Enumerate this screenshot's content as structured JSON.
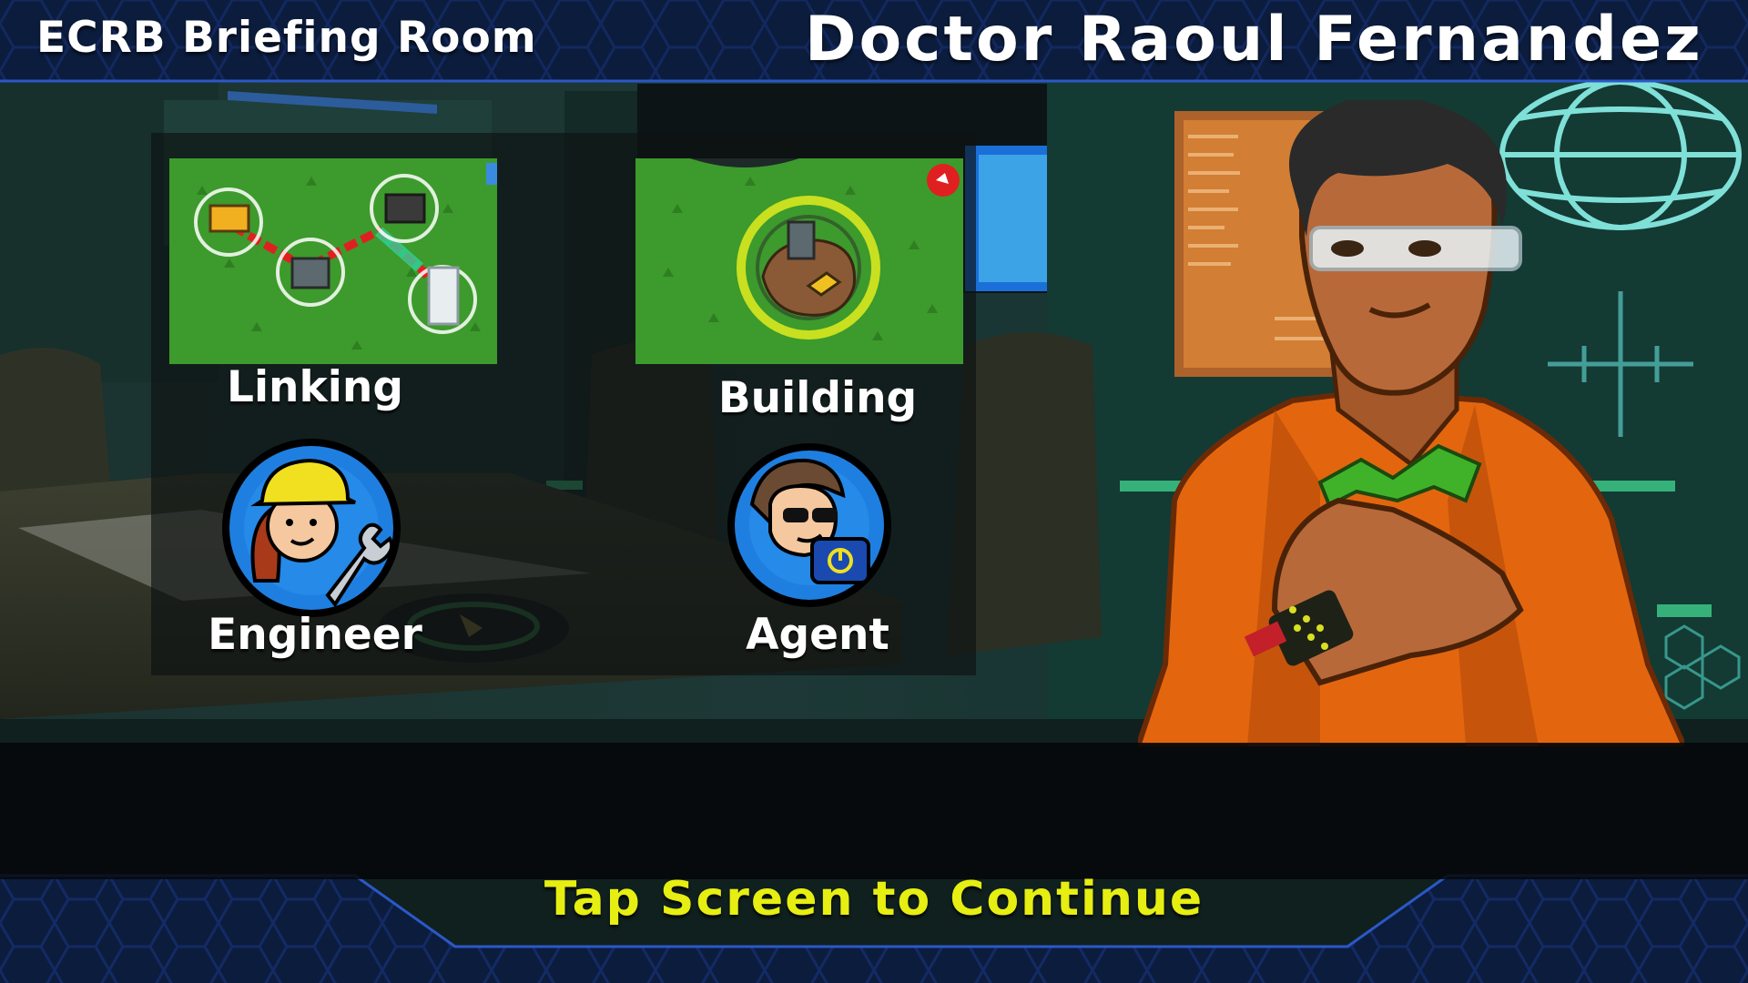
{
  "header": {
    "room_title": "ECRB Briefing Room",
    "character_name": "Doctor Raoul Fernandez"
  },
  "panel": {
    "modes": [
      {
        "label": "Linking",
        "thumbnail": "linking-map-thumbnail"
      },
      {
        "label": "Building",
        "thumbnail": "building-map-thumbnail"
      }
    ],
    "roles": [
      {
        "label": "Engineer",
        "icon": "engineer-icon"
      },
      {
        "label": "Agent",
        "icon": "agent-icon"
      }
    ]
  },
  "footer": {
    "continue_prompt": "Tap Screen to Continue"
  },
  "colors": {
    "prompt_yellow": "#e6ee12",
    "header_blue": "#0c1c3c",
    "role_circle_blue": "#1f7fe0",
    "character_shirt_orange": "#e3660f",
    "bow_tie_green": "#3fb22a",
    "map_grass_green": "#3d9a2c"
  }
}
